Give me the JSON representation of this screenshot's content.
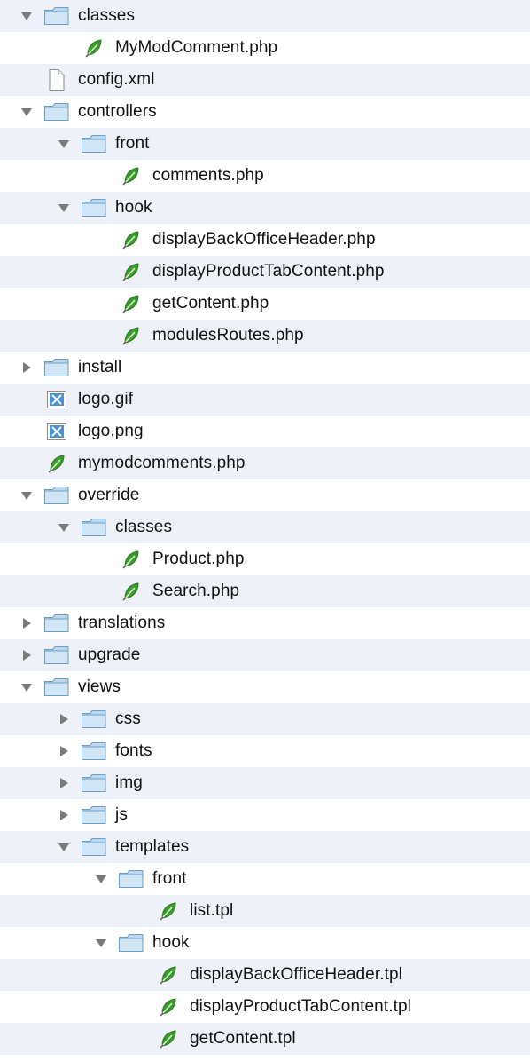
{
  "tree": [
    {
      "label": "classes",
      "type": "folder",
      "depth": 0,
      "state": "expanded"
    },
    {
      "label": "MyModComment.php",
      "type": "php",
      "depth": 1,
      "state": "none"
    },
    {
      "label": "config.xml",
      "type": "document",
      "depth": 0,
      "state": "none"
    },
    {
      "label": "controllers",
      "type": "folder",
      "depth": 0,
      "state": "expanded"
    },
    {
      "label": "front",
      "type": "folder",
      "depth": 1,
      "state": "expanded"
    },
    {
      "label": "comments.php",
      "type": "php",
      "depth": 2,
      "state": "none"
    },
    {
      "label": "hook",
      "type": "folder",
      "depth": 1,
      "state": "expanded"
    },
    {
      "label": "displayBackOfficeHeader.php",
      "type": "php",
      "depth": 2,
      "state": "none"
    },
    {
      "label": "displayProductTabContent.php",
      "type": "php",
      "depth": 2,
      "state": "none"
    },
    {
      "label": "getContent.php",
      "type": "php",
      "depth": 2,
      "state": "none"
    },
    {
      "label": "modulesRoutes.php",
      "type": "php",
      "depth": 2,
      "state": "none"
    },
    {
      "label": "install",
      "type": "folder",
      "depth": 0,
      "state": "collapsed"
    },
    {
      "label": "logo.gif",
      "type": "image",
      "depth": 0,
      "state": "none"
    },
    {
      "label": "logo.png",
      "type": "image",
      "depth": 0,
      "state": "none"
    },
    {
      "label": "mymodcomments.php",
      "type": "php",
      "depth": 0,
      "state": "none"
    },
    {
      "label": "override",
      "type": "folder",
      "depth": 0,
      "state": "expanded"
    },
    {
      "label": "classes",
      "type": "folder",
      "depth": 1,
      "state": "expanded"
    },
    {
      "label": "Product.php",
      "type": "php",
      "depth": 2,
      "state": "none"
    },
    {
      "label": "Search.php",
      "type": "php",
      "depth": 2,
      "state": "none"
    },
    {
      "label": "translations",
      "type": "folder",
      "depth": 0,
      "state": "collapsed"
    },
    {
      "label": "upgrade",
      "type": "folder",
      "depth": 0,
      "state": "collapsed"
    },
    {
      "label": "views",
      "type": "folder",
      "depth": 0,
      "state": "expanded"
    },
    {
      "label": "css",
      "type": "folder",
      "depth": 1,
      "state": "collapsed"
    },
    {
      "label": "fonts",
      "type": "folder",
      "depth": 1,
      "state": "collapsed"
    },
    {
      "label": "img",
      "type": "folder",
      "depth": 1,
      "state": "collapsed"
    },
    {
      "label": "js",
      "type": "folder",
      "depth": 1,
      "state": "collapsed"
    },
    {
      "label": "templates",
      "type": "folder",
      "depth": 1,
      "state": "expanded"
    },
    {
      "label": "front",
      "type": "folder",
      "depth": 2,
      "state": "expanded"
    },
    {
      "label": "list.tpl",
      "type": "php",
      "depth": 3,
      "state": "none"
    },
    {
      "label": "hook",
      "type": "folder",
      "depth": 2,
      "state": "expanded"
    },
    {
      "label": "displayBackOfficeHeader.tpl",
      "type": "php",
      "depth": 3,
      "state": "none"
    },
    {
      "label": "displayProductTabContent.tpl",
      "type": "php",
      "depth": 3,
      "state": "none"
    },
    {
      "label": "getContent.tpl",
      "type": "php",
      "depth": 3,
      "state": "none"
    }
  ],
  "icons": {
    "folder": "folder-icon",
    "php": "php-file-icon",
    "document": "document-icon",
    "image": "image-file-icon"
  },
  "colors": {
    "stripe": "#eef2f8",
    "folder_fill": "#bcd7ee",
    "folder_stroke": "#6d9ec8",
    "leaf_green": "#3d9a2f",
    "disclosure": "#7a7a7a"
  }
}
